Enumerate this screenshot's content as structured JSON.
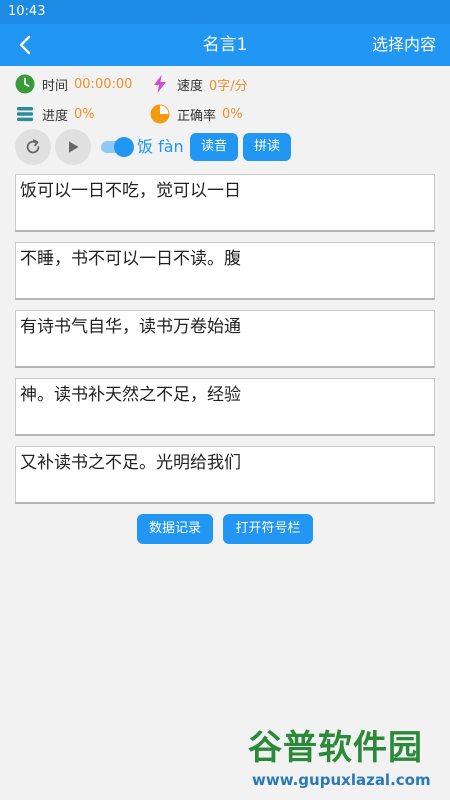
{
  "status_bar": {
    "time": "10:43"
  },
  "header": {
    "title": "名言1",
    "select_label": "选择内容",
    "back_icon": "back-arrow-icon"
  },
  "stats": {
    "time": {
      "label": "时间",
      "value": "00:00:00"
    },
    "speed": {
      "label": "速度",
      "value": "0字/分"
    },
    "progress": {
      "label": "进度",
      "value": "0%"
    },
    "accuracy": {
      "label": "正确率",
      "value": "0%"
    }
  },
  "controls": {
    "pinyin_label": "饭 fàn",
    "pinyin_toggle_on": true,
    "read_aloud_label": "读音",
    "spell_label": "拼读"
  },
  "lines": [
    "饭可以一日不吃，觉可以一日",
    "不睡，书不可以一日不读。腹",
    "有诗书气自华，读书万卷始通",
    "神。读书补天然之不足，经验",
    "又补读书之不足。光明给我们"
  ],
  "buttons": {
    "records_label": "数据记录",
    "symbols_label": "打开符号栏"
  },
  "watermark": {
    "title": "谷普软件园",
    "url": "www.gupuxlazal.com"
  },
  "colors": {
    "primary": "#2196f3",
    "accent": "#f0922b"
  }
}
